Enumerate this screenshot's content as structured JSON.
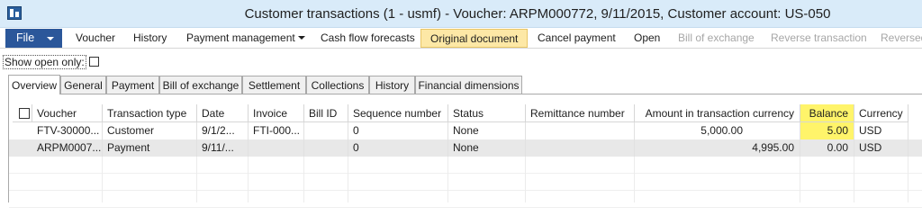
{
  "window": {
    "title": "Customer transactions (1 - usmf) - Voucher: ARPM000772, 9/11/2015, Customer account: US-050"
  },
  "ribbon": {
    "file_label": "File",
    "items": [
      {
        "label": "Voucher",
        "state": "normal"
      },
      {
        "label": "History",
        "state": "normal"
      },
      {
        "label": "Payment management",
        "state": "normal"
      },
      {
        "label": "Cash flow forecasts",
        "state": "normal"
      },
      {
        "label": "Original document",
        "state": "highlighted"
      },
      {
        "label": "Cancel payment",
        "state": "normal"
      },
      {
        "label": "Open",
        "state": "normal"
      },
      {
        "label": "Bill of exchange",
        "state": "disabled"
      },
      {
        "label": "Reverse transaction",
        "state": "disabled"
      },
      {
        "label": "Reversed",
        "state": "disabled"
      }
    ]
  },
  "filter": {
    "show_open_only_label": "Show open only:",
    "show_open_only_checked": false
  },
  "tabs": [
    "Overview",
    "General",
    "Payment",
    "Bill of exchange",
    "Settlement",
    "Collections",
    "History",
    "Financial dimensions"
  ],
  "active_tab": "Overview",
  "grid": {
    "columns": [
      "Voucher",
      "Transaction type",
      "Date",
      "Invoice",
      "Bill ID",
      "Sequence number",
      "Status",
      "Remittance number",
      "Amount in transaction currency",
      "Balance",
      "Currency"
    ],
    "rows": [
      {
        "voucher": "FTV-30000...",
        "type": "Customer",
        "date": "9/1/2...",
        "invoice": "FTI-000...",
        "bill_id": "",
        "sequence": "0",
        "status": "None",
        "remittance": "",
        "amount": "5,000.00",
        "balance": "5.00",
        "currency": "USD"
      },
      {
        "voucher": "ARPM0007...",
        "type": "Payment",
        "date": "9/11/...",
        "invoice": "",
        "bill_id": "",
        "sequence": "0",
        "status": "None",
        "remittance": "",
        "amount": "4,995.00",
        "balance": "0.00",
        "currency": "USD"
      }
    ]
  },
  "colors": {
    "title_bar": "#d9ebf9",
    "file_button": "#2b579a",
    "highlight_button": "#fde8a6",
    "balance_highlight": "#fff46a"
  }
}
